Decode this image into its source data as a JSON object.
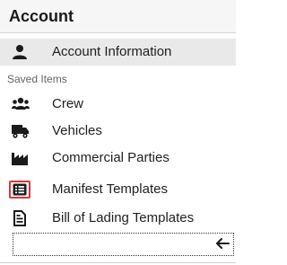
{
  "header": {
    "title": "Account"
  },
  "account_item": {
    "label": "Account Information",
    "icon": "user-icon"
  },
  "section": {
    "label": "Saved Items"
  },
  "saved_items": [
    {
      "label": "Crew",
      "icon": "users-icon"
    },
    {
      "label": "Vehicles",
      "icon": "truck-icon"
    },
    {
      "label": "Commercial Parties",
      "icon": "factory-icon"
    },
    {
      "label": "Manifest Templates",
      "icon": "list-box-icon"
    },
    {
      "label": "Bill of Lading Templates",
      "icon": "document-icon"
    }
  ],
  "bottom": {
    "arrow": "🡐"
  },
  "colors": {
    "highlight": "#e0353a",
    "active_bg": "#e9e9e9"
  }
}
